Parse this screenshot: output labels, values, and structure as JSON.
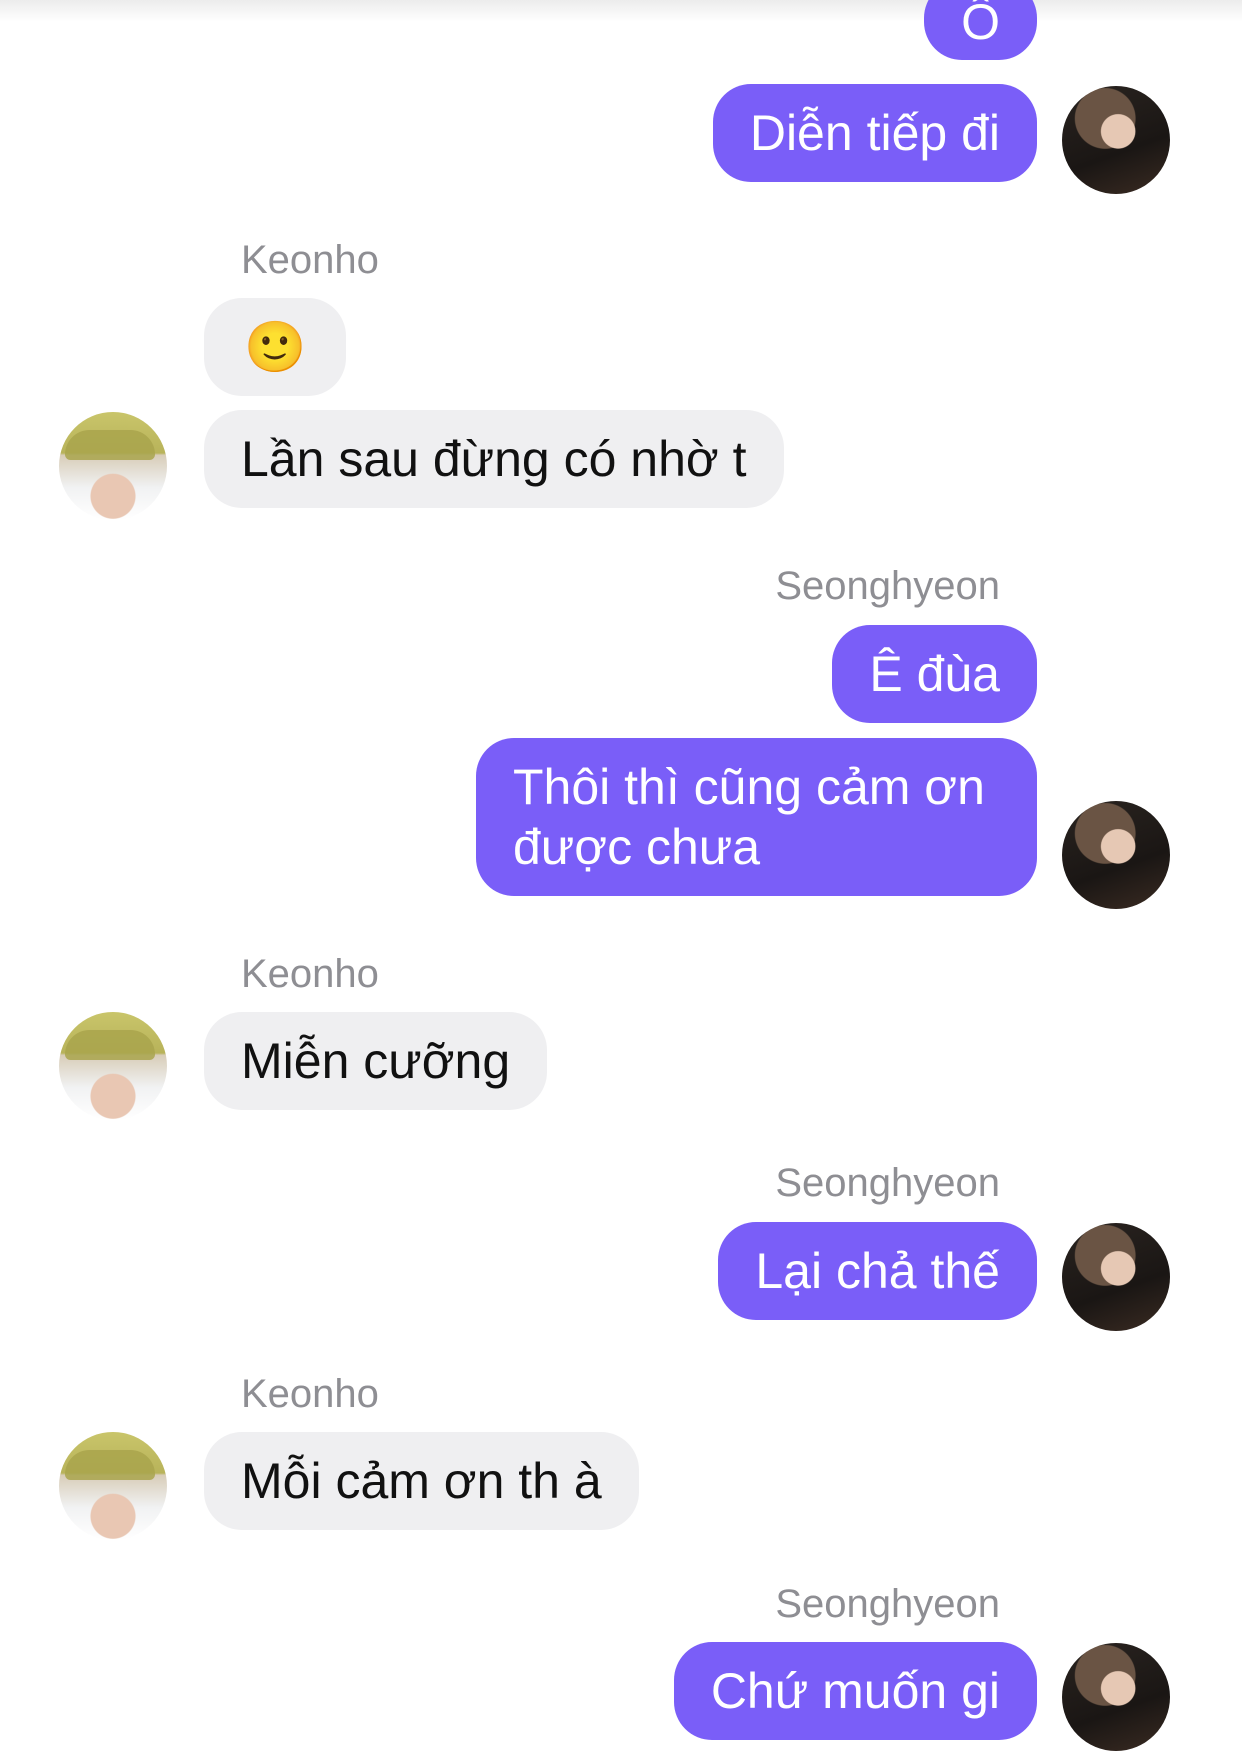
{
  "conversation": {
    "contact_name": "Keonho",
    "self_name": "Seonghyeon"
  },
  "messages": [
    {
      "sender": "Seonghyeon",
      "text": "Ô"
    },
    {
      "sender": "Seonghyeon",
      "text": "Diễn tiếp đi"
    },
    {
      "sender": "Keonho",
      "text": "🙂"
    },
    {
      "sender": "Keonho",
      "text": "Lần sau đừng có nhờ t"
    },
    {
      "sender": "Seonghyeon",
      "text": "Ê đùa"
    },
    {
      "sender": "Seonghyeon",
      "text": "Thôi thì cũng cảm ơn được chưa"
    },
    {
      "sender": "Keonho",
      "text": "Miễn cưỡng"
    },
    {
      "sender": "Seonghyeon",
      "text": "Lại chả thế"
    },
    {
      "sender": "Keonho",
      "text": "Mỗi cảm ơn th à"
    },
    {
      "sender": "Seonghyeon",
      "text": "Chứ muốn gi"
    }
  ],
  "colors": {
    "outgoing_bubble": "#7a5ef8",
    "incoming_bubble": "#efeff1",
    "sender_name": "#8e8e93"
  }
}
